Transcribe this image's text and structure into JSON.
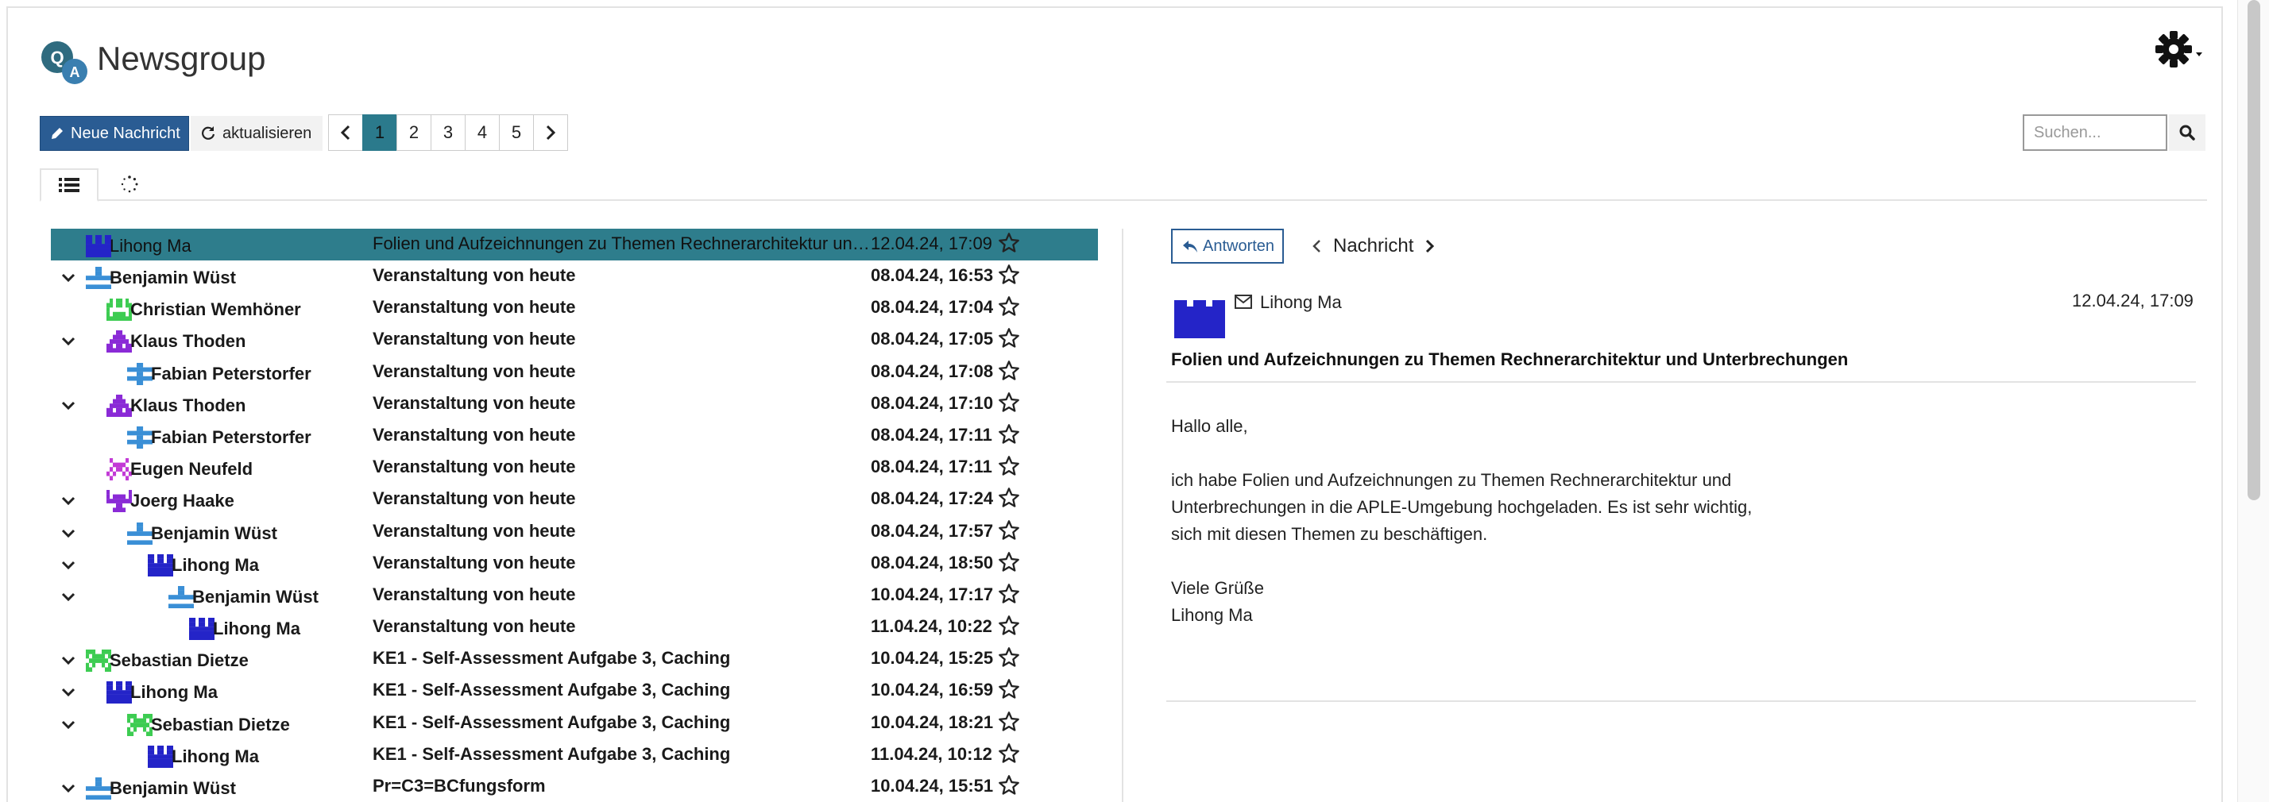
{
  "app": {
    "title": "Newsgroup",
    "logo": "qa-logo",
    "settings_icon": "gear-icon"
  },
  "toolbar": {
    "new_message_label": "Neue Nachricht",
    "refresh_label": "aktualisieren",
    "pages": [
      "1",
      "2",
      "3",
      "4",
      "5"
    ],
    "active_page": "1",
    "search_placeholder": "Suchen..."
  },
  "view_tabs": [
    "list-icon",
    "spinner-icon"
  ],
  "colors": {
    "primary": "#2a5c93",
    "selected_row": "#2e7d8c",
    "border": "#e3e3e3"
  },
  "messages": [
    {
      "author": "Lihong Ma",
      "subject": "Folien und Aufzeichnungen zu Themen Rechnerarchitektur und Unterbrechungen",
      "date": "12.04.24, 17:09",
      "level": 0,
      "expand": false,
      "avatar": "ma",
      "selected": true,
      "unread": false
    },
    {
      "author": "Benjamin Wüst",
      "subject": "Veranstaltung von heute",
      "date": "08.04.24, 16:53",
      "level": 0,
      "expand": true,
      "avatar": "wuest",
      "selected": false,
      "unread": true
    },
    {
      "author": "Christian Wemhöner",
      "subject": "Veranstaltung von heute",
      "date": "08.04.24, 17:04",
      "level": 1,
      "expand": false,
      "avatar": "wemhoener",
      "selected": false,
      "unread": true
    },
    {
      "author": "Klaus Thoden",
      "subject": "Veranstaltung von heute",
      "date": "08.04.24, 17:05",
      "level": 1,
      "expand": true,
      "avatar": "thoden",
      "selected": false,
      "unread": true
    },
    {
      "author": "Fabian Peterstorfer",
      "subject": "Veranstaltung von heute",
      "date": "08.04.24, 17:08",
      "level": 2,
      "expand": false,
      "avatar": "peterstorfer",
      "selected": false,
      "unread": true
    },
    {
      "author": "Klaus Thoden",
      "subject": "Veranstaltung von heute",
      "date": "08.04.24, 17:10",
      "level": 1,
      "expand": true,
      "avatar": "thoden",
      "selected": false,
      "unread": true
    },
    {
      "author": "Fabian Peterstorfer",
      "subject": "Veranstaltung von heute",
      "date": "08.04.24, 17:11",
      "level": 2,
      "expand": false,
      "avatar": "peterstorfer",
      "selected": false,
      "unread": true
    },
    {
      "author": "Eugen Neufeld",
      "subject": "Veranstaltung von heute",
      "date": "08.04.24, 17:11",
      "level": 1,
      "expand": false,
      "avatar": "neufeld",
      "selected": false,
      "unread": true
    },
    {
      "author": "Joerg Haake",
      "subject": "Veranstaltung von heute",
      "date": "08.04.24, 17:24",
      "level": 1,
      "expand": true,
      "avatar": "haake",
      "selected": false,
      "unread": true
    },
    {
      "author": "Benjamin Wüst",
      "subject": "Veranstaltung von heute",
      "date": "08.04.24, 17:57",
      "level": 2,
      "expand": true,
      "avatar": "wuest",
      "selected": false,
      "unread": true
    },
    {
      "author": "Lihong Ma",
      "subject": "Veranstaltung von heute",
      "date": "08.04.24, 18:50",
      "level": 3,
      "expand": true,
      "avatar": "ma",
      "selected": false,
      "unread": true
    },
    {
      "author": "Benjamin Wüst",
      "subject": "Veranstaltung von heute",
      "date": "10.04.24, 17:17",
      "level": 4,
      "expand": true,
      "avatar": "wuest",
      "selected": false,
      "unread": true
    },
    {
      "author": "Lihong Ma",
      "subject": "Veranstaltung von heute",
      "date": "11.04.24, 10:22",
      "level": 5,
      "expand": false,
      "avatar": "ma",
      "selected": false,
      "unread": true
    },
    {
      "author": "Sebastian Dietze",
      "subject": "KE1 - Self-Assessment Aufgabe 3, Caching",
      "date": "10.04.24, 15:25",
      "level": 0,
      "expand": true,
      "avatar": "dietze",
      "selected": false,
      "unread": true
    },
    {
      "author": "Lihong Ma",
      "subject": "KE1 - Self-Assessment Aufgabe 3, Caching",
      "date": "10.04.24, 16:59",
      "level": 1,
      "expand": true,
      "avatar": "ma",
      "selected": false,
      "unread": true
    },
    {
      "author": "Sebastian Dietze",
      "subject": "KE1 - Self-Assessment Aufgabe 3, Caching",
      "date": "10.04.24, 18:21",
      "level": 2,
      "expand": true,
      "avatar": "dietze",
      "selected": false,
      "unread": true
    },
    {
      "author": "Lihong Ma",
      "subject": "KE1 - Self-Assessment Aufgabe 3, Caching",
      "date": "11.04.24, 10:12",
      "level": 3,
      "expand": false,
      "avatar": "ma",
      "selected": false,
      "unread": true
    },
    {
      "author": "Benjamin Wüst",
      "subject": "Pr=C3=BCfungsform",
      "date": "10.04.24, 15:51",
      "level": 0,
      "expand": true,
      "avatar": "wuest",
      "selected": false,
      "unread": true
    }
  ],
  "reader": {
    "reply_label": "Antworten",
    "nav_label": "Nachricht",
    "from": "Lihong Ma",
    "date": "12.04.24, 17:09",
    "subject": "Folien und Aufzeichnungen zu Themen Rechnerarchitektur und Unterbrechungen",
    "body_lines": [
      "Hallo alle,",
      "",
      "ich habe Folien und Aufzeichnungen zu Themen Rechnerarchitektur und",
      "Unterbrechungen in die APLE-Umgebung hochgeladen. Es ist sehr wichtig,",
      "sich mit diesen Themen zu beschäftigen.",
      "",
      "Viele Grüße",
      "Lihong Ma"
    ]
  }
}
